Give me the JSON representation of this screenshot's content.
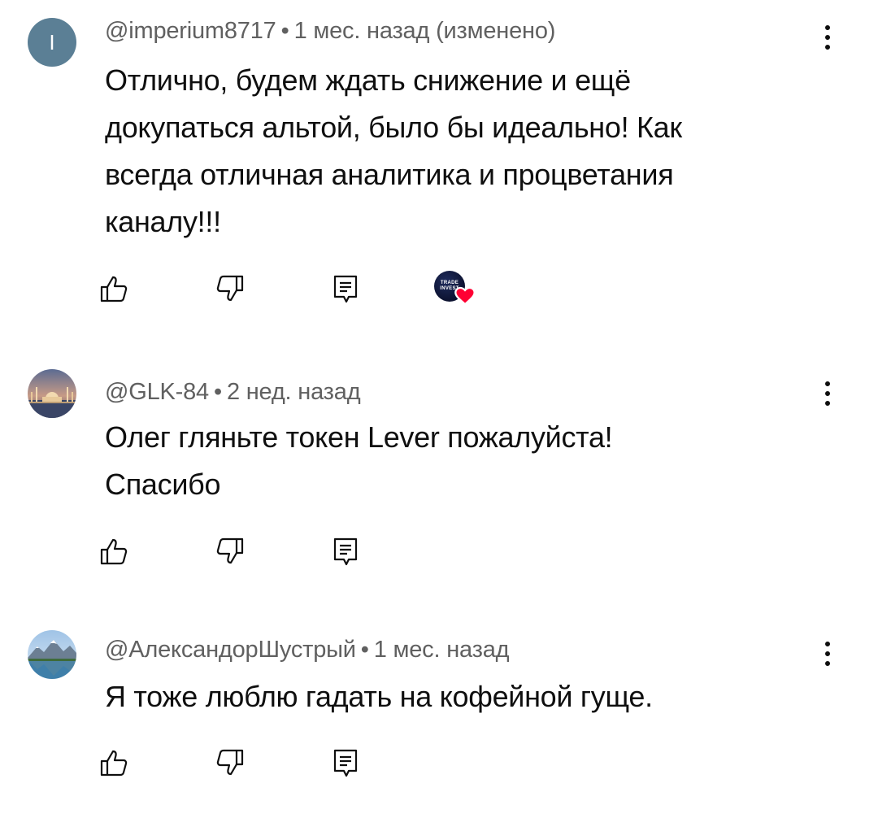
{
  "comments": [
    {
      "author": "@imperium8717",
      "avatar_letter": "I",
      "time": "1 мес. назад",
      "edited": "(изменено)",
      "separator": "•",
      "text_lines": [
        "Отлично, будем ждать снижение и ещё",
        "докупаться альтой, было бы идеально! Как",
        "всегда отличная аналитика и процветания",
        "каналу!!!"
      ],
      "creator_heart": {
        "avatar_text_line1": "TRADE",
        "avatar_text_line2": "INVEST",
        "heart_color": "#ff0033"
      }
    },
    {
      "author": "@GLK-84",
      "time": "2 нед. назад",
      "separator": "•",
      "text_lines": [
        "Олег гляньте токен Lever пожалуйста!",
        "Спасибо"
      ]
    },
    {
      "author": "@АлександорШустрый",
      "time": "1 мес. назад",
      "separator": "•",
      "text_lines": [
        "Я тоже люблю гадать на кофейной гуще."
      ]
    }
  ],
  "icons": {
    "like": "thumb-up-icon",
    "dislike": "thumb-down-icon",
    "reply": "reply-comment-icon",
    "menu": "more-vertical-icon"
  },
  "colors": {
    "meta_text": "#606060",
    "body_text": "#0f0f0f",
    "avatar_letter_bg": "#5b7f95"
  }
}
